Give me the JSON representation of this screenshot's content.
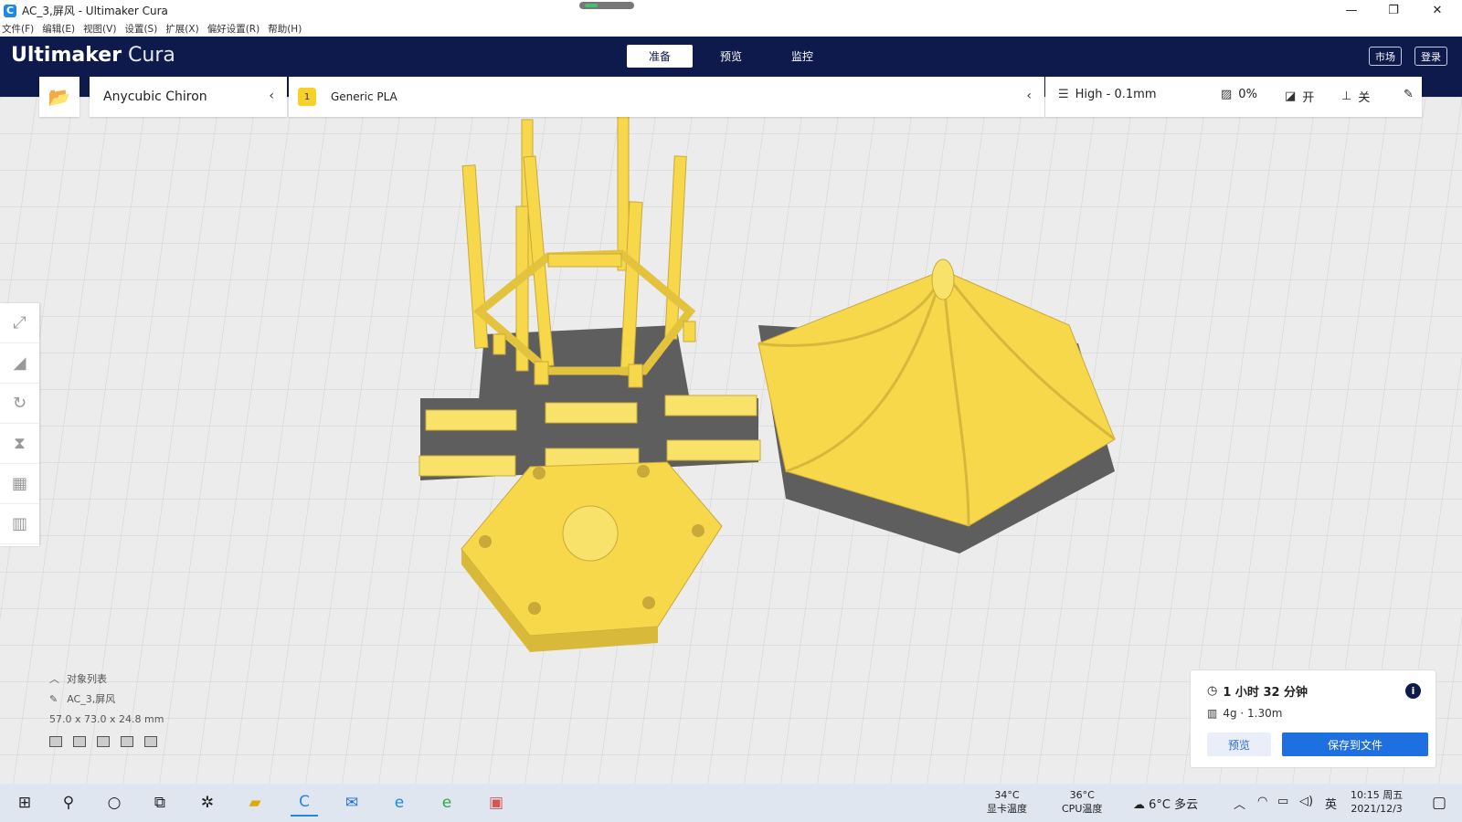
{
  "window": {
    "title": "AC_3,屏风 - Ultimaker Cura",
    "minimize": "—",
    "restore": "❐",
    "close": "✕"
  },
  "menu": [
    "文件(F)",
    "编辑(E)",
    "视图(V)",
    "设置(S)",
    "扩展(X)",
    "偏好设置(R)",
    "帮助(H)"
  ],
  "header": {
    "brand_bold": "Ultimaker",
    "brand_light": "Cura",
    "tabs": [
      "准备",
      "预览",
      "监控"
    ],
    "active_tab": "准备",
    "marketplace": "市场",
    "login": "登录"
  },
  "toolbar": {
    "printer": "Anycubic Chiron",
    "material_badge": "1",
    "material": "Generic PLA",
    "profile": "High - 0.1mm",
    "infill": "0%",
    "support": "开",
    "adhesion": "关"
  },
  "object_list": {
    "toggle_label": "对象列表",
    "object_name": "AC_3,屏风",
    "dimensions": "57.0 x 73.0 x 24.8 mm"
  },
  "print_panel": {
    "time": "1 小时 32 分钟",
    "material_usage": "4g · 1.30m",
    "preview_button": "预览",
    "save_button": "保存到文件"
  },
  "taskbar": {
    "gpu_temp": "34°C",
    "gpu_label": "显卡温度",
    "cpu_temp": "36°C",
    "cpu_label": "CPU温度",
    "weather": "6°C 多云",
    "ime": "英",
    "time": "10:15 周五",
    "date": "2021/12/3"
  },
  "colors": {
    "header_bg": "#0f1a4c",
    "model_yellow": "#f8e26a",
    "accent_blue": "#1e6fe0"
  }
}
